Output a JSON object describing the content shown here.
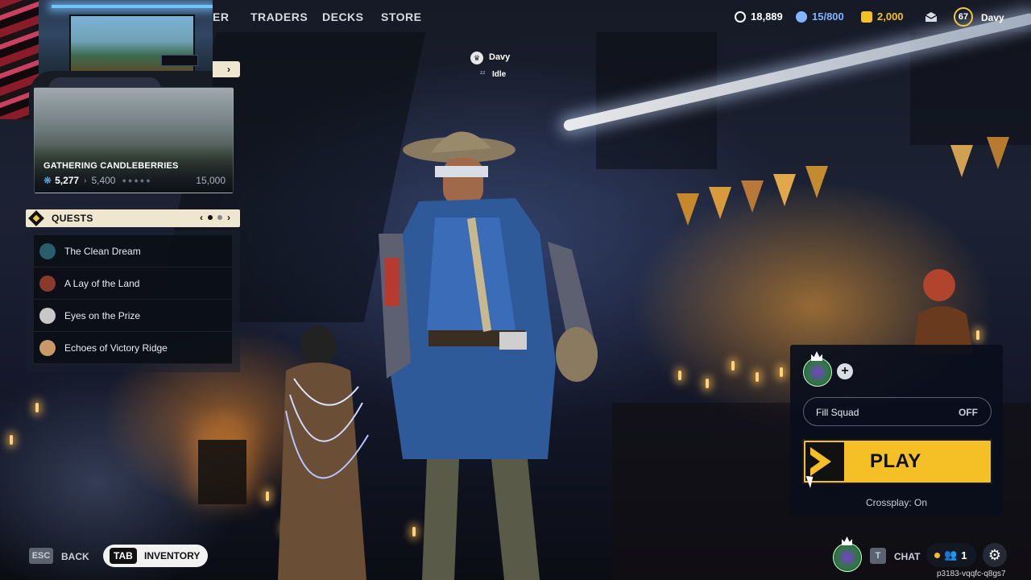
{
  "nav": {
    "items": [
      "ER",
      "TRADERS",
      "DECKS",
      "STORE"
    ]
  },
  "currencies": [
    {
      "value": "18,889",
      "icon": "coin-icon",
      "color": "#ffffff"
    },
    {
      "value": "15/800",
      "icon": "premium-token-icon",
      "color": "#7fb6ff"
    },
    {
      "value": "2,000",
      "icon": "gold-icon",
      "color": "#f5c026"
    }
  ],
  "profile": {
    "level": "67",
    "name": "Davy",
    "mail_icon": "mail-icon"
  },
  "season": {
    "title": "GATHERING CANDLEBERRIES",
    "current": "5,277",
    "next": "5,400",
    "max": "15,000"
  },
  "quests": {
    "title": "QUESTS",
    "page": 1,
    "pages": 2,
    "items": [
      {
        "label": "The Clean Dream",
        "avatar_color": "#2a5d6b"
      },
      {
        "label": "A Lay of the Land",
        "avatar_color": "#8a3a2a"
      },
      {
        "label": "Eyes on the Prize",
        "avatar_color": "#c8c8c8"
      },
      {
        "label": "Echoes of Victory Ridge",
        "avatar_color": "#c89a6a"
      }
    ]
  },
  "player_status": {
    "name": "Davy",
    "status": "Idle"
  },
  "squad": {
    "fill_label": "Fill Squad",
    "fill_value": "OFF",
    "play_label": "PLAY",
    "crossplay": "Crossplay: On"
  },
  "bottom": {
    "esc_key": "ESC",
    "back_label": "BACK",
    "tab_key": "TAB",
    "inventory_label": "INVENTORY",
    "chat_key": "T",
    "chat_label": "CHAT",
    "friends_count": "1",
    "session_code": "p3183-vqqfc-q8gs7"
  },
  "colors": {
    "accent_yellow": "#f5c026",
    "panel_cream": "#efe6cf",
    "panel_dark": "#0a0e16"
  }
}
